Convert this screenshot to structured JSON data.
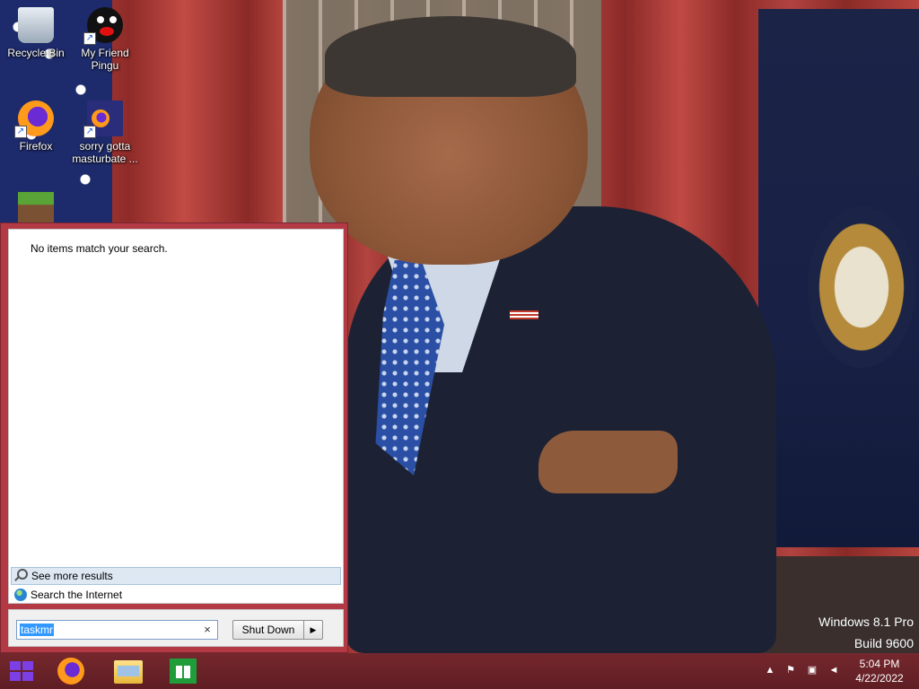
{
  "desktop": {
    "icons": [
      {
        "label": "Recycle Bin",
        "icon": "recycle-bin-icon"
      },
      {
        "label": "My Friend Pingu",
        "icon": "pingu-icon"
      },
      {
        "label": "Firefox",
        "icon": "firefox-icon"
      },
      {
        "label": "sorry gotta masturbate ...",
        "icon": "firefox-file-icon"
      },
      {
        "label": "",
        "icon": "minecraft-icon"
      }
    ]
  },
  "start_panel": {
    "no_results": "No items match your search.",
    "see_more": "See more results",
    "search_internet": "Search the Internet",
    "search_value": "taskmr",
    "clear_symbol": "×",
    "shutdown_label": "Shut Down",
    "shutdown_arrow": "▶"
  },
  "watermark": {
    "edition": "Windows 8.1 Pro",
    "build": "Build 9600"
  },
  "taskbar": {
    "apps": [
      "start-icon",
      "firefox-icon",
      "file-explorer-icon",
      "store-icon"
    ],
    "tray": {
      "show_hidden": "▲",
      "time": "5:04 PM",
      "date": "4/22/2022"
    }
  },
  "colors": {
    "panel_accent": "#b33a45",
    "taskbar": "#6e2529",
    "selection": "#3399ff"
  }
}
